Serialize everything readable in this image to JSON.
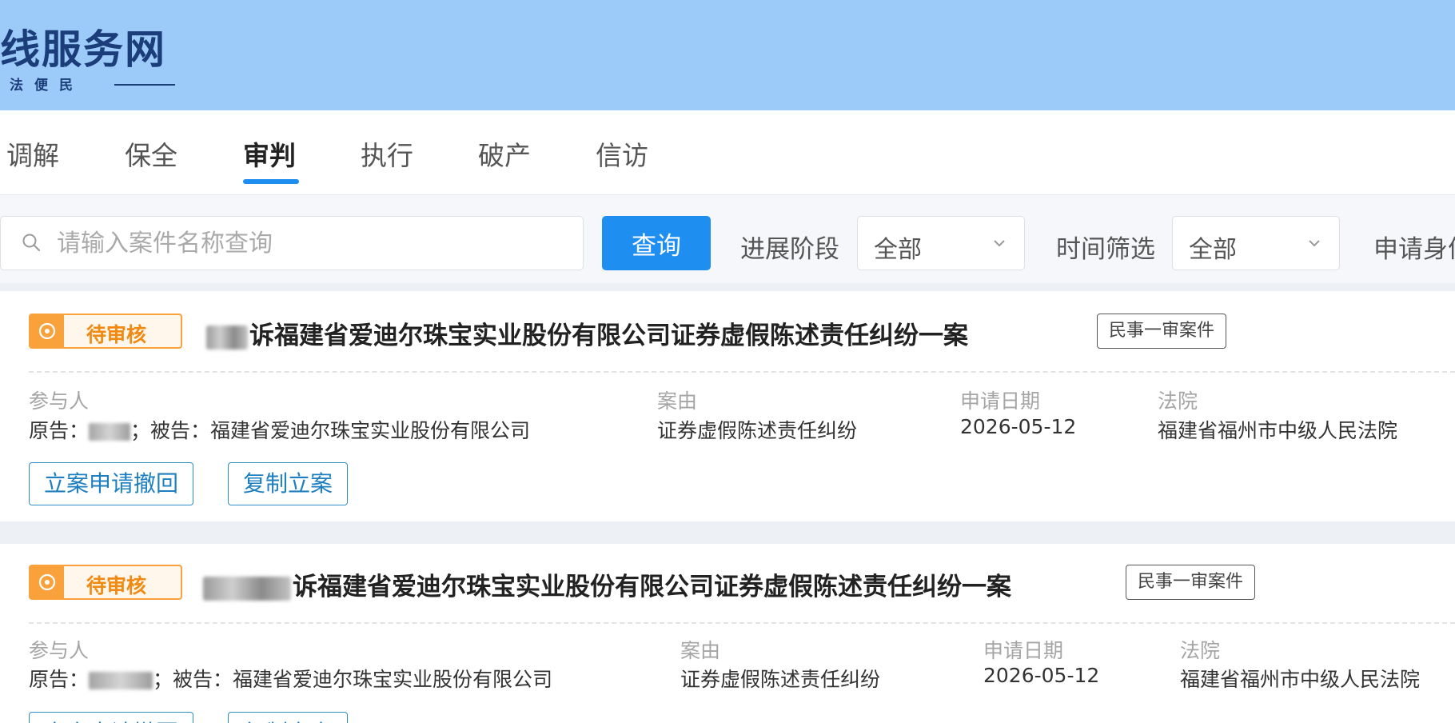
{
  "header": {
    "site_title": "线服务网",
    "site_subtitle": "法便民"
  },
  "nav": {
    "tabs": [
      {
        "label": "调解"
      },
      {
        "label": "保全"
      },
      {
        "label": "审判"
      },
      {
        "label": "执行"
      },
      {
        "label": "破产"
      },
      {
        "label": "信访"
      }
    ],
    "active_tab": "审判"
  },
  "filters": {
    "search_placeholder": "请输入案件名称查询",
    "search_value": "",
    "query_button": "查询",
    "stage_label": "进展阶段",
    "stage_value": "全部",
    "time_label": "时间筛选",
    "time_value": "全部",
    "identity_label": "申请身份"
  },
  "cases": [
    {
      "status": "待审核",
      "title_suffix": "诉福建省爱迪尔珠宝实业股份有限公司证券虚假陈述责任纠纷一案",
      "case_type": "民事一审案件",
      "participants_label": "参与人",
      "plaintiff_label": "原告：",
      "defendant_text": "；被告：福建省爱迪尔珠宝实业股份有限公司",
      "cause_label": "案由",
      "cause_value": "证券虚假陈述责任纠纷",
      "date_label": "申请日期",
      "date_value": "2026-05-12",
      "court_label": "法院",
      "court_value": "福建省福州市中级人民法院",
      "actions": [
        "立案申请撤回",
        "复制立案"
      ]
    },
    {
      "status": "待审核",
      "title_suffix": "诉福建省爱迪尔珠宝实业股份有限公司证券虚假陈述责任纠纷一案",
      "case_type": "民事一审案件",
      "participants_label": "参与人",
      "plaintiff_label": "原告：",
      "defendant_text": "；被告：福建省爱迪尔珠宝实业股份有限公司",
      "cause_label": "案由",
      "cause_value": "证券虚假陈述责任纠纷",
      "date_label": "申请日期",
      "date_value": "2026-05-12",
      "court_label": "法院",
      "court_value": "福建省福州市中级人民法院",
      "actions": [
        "立案申请撤回",
        "复制立案"
      ]
    }
  ]
}
